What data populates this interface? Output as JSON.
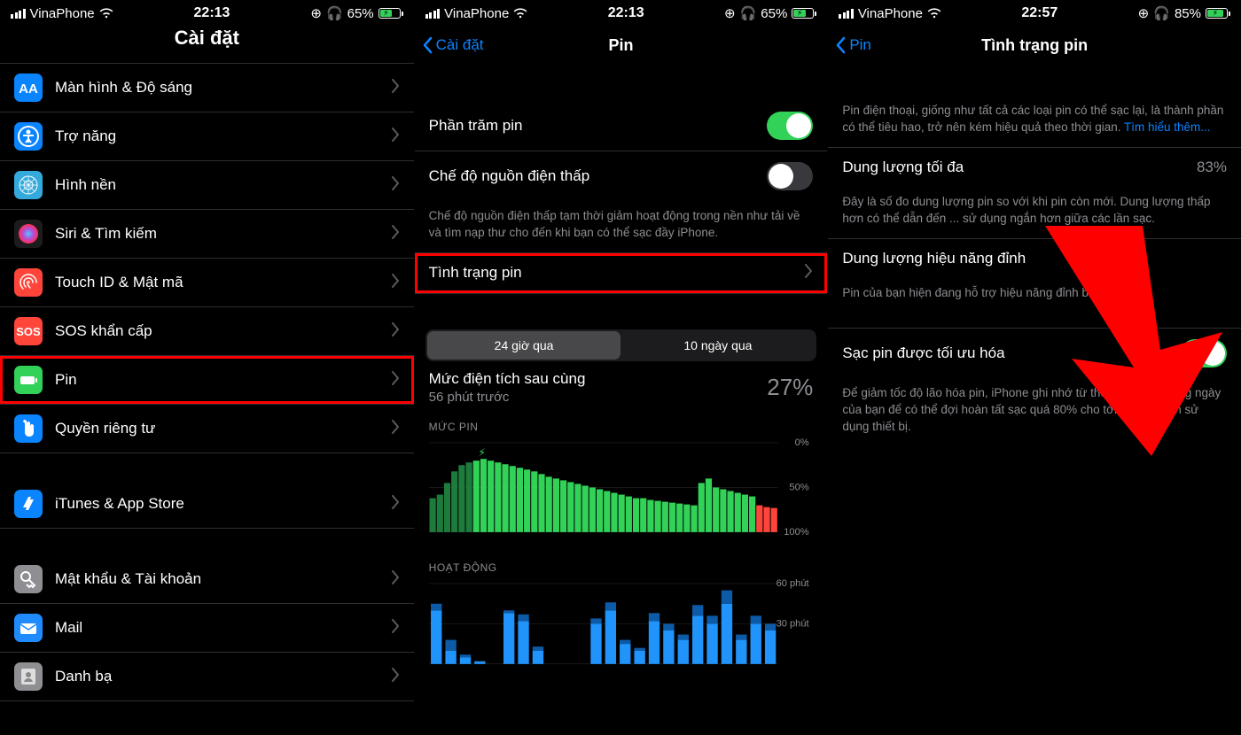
{
  "screen1": {
    "status": {
      "carrier": "VinaPhone",
      "time": "22:13",
      "battery_pct": "65%",
      "battery_fill": 65
    },
    "title": "Cài đặt",
    "items": [
      {
        "label": "Màn hình & Độ sáng",
        "icon": "display",
        "color": "#0a84ff"
      },
      {
        "label": "Trợ năng",
        "icon": "access",
        "color": "#0a84ff"
      },
      {
        "label": "Hình nền",
        "icon": "wall",
        "color": "#34aadc"
      },
      {
        "label": "Siri & Tìm kiếm",
        "icon": "siri",
        "color": "#1c1c1e"
      },
      {
        "label": "Touch ID & Mật mã",
        "icon": "touch",
        "color": "#ff453a"
      },
      {
        "label": "SOS khẩn cấp",
        "icon": "sos",
        "color": "#ff453a"
      },
      {
        "label": "Pin",
        "icon": "batt",
        "color": "#32d158",
        "highlight": true
      },
      {
        "label": "Quyền riêng tư",
        "icon": "hand",
        "color": "#0a84ff"
      }
    ],
    "items2": [
      {
        "label": "iTunes & App Store",
        "icon": "appstore",
        "color": "#0a84ff"
      }
    ],
    "items3": [
      {
        "label": "Mật khẩu & Tài khoản",
        "icon": "key",
        "color": "#8e8e93"
      },
      {
        "label": "Mail",
        "icon": "mail",
        "color": "#1f8bff"
      },
      {
        "label": "Danh bạ",
        "icon": "contact",
        "color": "#8e8e93"
      }
    ]
  },
  "screen2": {
    "status": {
      "carrier": "VinaPhone",
      "time": "22:13",
      "battery_pct": "65%",
      "battery_fill": 65
    },
    "back": "Cài đặt",
    "title": "Pin",
    "rows": [
      {
        "label": "Phần trăm pin",
        "toggle": true
      },
      {
        "label": "Chế độ nguồn điện thấp",
        "toggle": false
      }
    ],
    "low_power_note": "Chế độ nguồn điện thấp tạm thời giảm hoạt động trong nền như tải về và tìm nạp thư cho đến khi bạn có thể sạc đầy iPhone.",
    "battery_health": "Tình trạng pin",
    "seg_24h": "24 giờ qua",
    "seg_10d": "10 ngày qua",
    "last_charge_title": "Mức điện tích sau cùng",
    "last_charge_sub": "56 phút trước",
    "last_charge_pct": "27%",
    "chart_battery_label": "MỨC PIN",
    "chart_activity_label": "HOẠT ĐỘNG",
    "chart_battery_ticks": [
      "100%",
      "50%",
      "0%"
    ],
    "chart_activity_ticks": [
      "60 phút",
      "30 phút"
    ]
  },
  "screen3": {
    "status": {
      "carrier": "VinaPhone",
      "time": "22:57",
      "battery_pct": "85%",
      "battery_fill": 85
    },
    "back": "Pin",
    "title": "Tình trạng pin",
    "intro": "Pin điện thoại, giống như tất cả các loại pin có thể sạc lại, là thành phần có thể tiêu hao, trở nên kém hiệu quả theo thời gian. ",
    "intro_link": "Tìm hiểu thêm...",
    "max_capacity_label": "Dung lượng tối đa",
    "max_capacity_value": "83%",
    "max_capacity_note": "Đây là số đo dung lượng pin so với khi pin còn mới. Dung lượng thấp hơn có thể dẫn đến ... sử dụng ngắn hơn giữa các lần sạc.",
    "peak_perf_label": "Dung lượng hiệu năng đỉnh",
    "peak_perf_note": "Pin của bạn hiện đang hỗ trợ hiệu năng đỉnh bình thường.",
    "opt_charge_label": "Sạc pin được tối ưu hóa",
    "opt_charge_note": "Để giảm tốc độ lão hóa pin, iPhone ghi nhớ từ thói quen sạc hàng ngày của bạn để có thể đợi hoàn tất sạc quá 80% cho tới khi bạn cần sử dụng thiết bị."
  },
  "chart_data": [
    {
      "type": "bar",
      "title": "MỨC PIN",
      "ylabel": "%",
      "ylim": [
        0,
        100
      ],
      "series": [
        {
          "name": "level",
          "values": [
            38,
            42,
            55,
            68,
            75,
            78,
            80,
            82,
            80,
            78,
            76,
            74,
            72,
            70,
            68,
            65,
            62,
            60,
            58,
            56,
            54,
            52,
            50,
            48,
            46,
            44,
            42,
            40,
            38,
            38,
            36,
            35,
            34,
            33,
            32,
            31,
            30,
            55,
            60,
            50,
            48,
            46,
            44,
            42,
            40,
            30,
            28,
            27
          ]
        },
        {
          "name": "charging",
          "values": [
            1,
            1,
            1,
            1,
            1,
            1,
            0,
            0,
            0,
            0,
            0,
            0,
            0,
            0,
            0,
            0,
            0,
            0,
            0,
            0,
            0,
            0,
            0,
            0,
            0,
            0,
            0,
            0,
            0,
            0,
            0,
            0,
            0,
            0,
            0,
            0,
            0,
            0,
            0,
            0,
            0,
            0,
            0,
            0,
            0,
            0,
            0,
            0
          ]
        },
        {
          "name": "low",
          "values": [
            0,
            0,
            0,
            0,
            0,
            0,
            0,
            0,
            0,
            0,
            0,
            0,
            0,
            0,
            0,
            0,
            0,
            0,
            0,
            0,
            0,
            0,
            0,
            0,
            0,
            0,
            0,
            0,
            0,
            0,
            0,
            0,
            0,
            0,
            0,
            0,
            0,
            0,
            0,
            0,
            0,
            0,
            0,
            0,
            0,
            1,
            1,
            1
          ]
        }
      ]
    },
    {
      "type": "bar",
      "title": "HOẠT ĐỘNG",
      "ylabel": "phút",
      "ylim": [
        0,
        60
      ],
      "series": [
        {
          "name": "screen_on",
          "values": [
            40,
            10,
            5,
            2,
            0,
            38,
            32,
            10,
            0,
            0,
            0,
            30,
            40,
            15,
            10,
            32,
            25,
            18,
            36,
            30,
            45,
            18,
            30,
            25
          ]
        },
        {
          "name": "screen_off",
          "values": [
            5,
            8,
            2,
            0,
            0,
            2,
            5,
            3,
            0,
            0,
            0,
            4,
            6,
            3,
            2,
            6,
            5,
            4,
            8,
            6,
            10,
            4,
            6,
            5
          ]
        }
      ]
    }
  ]
}
